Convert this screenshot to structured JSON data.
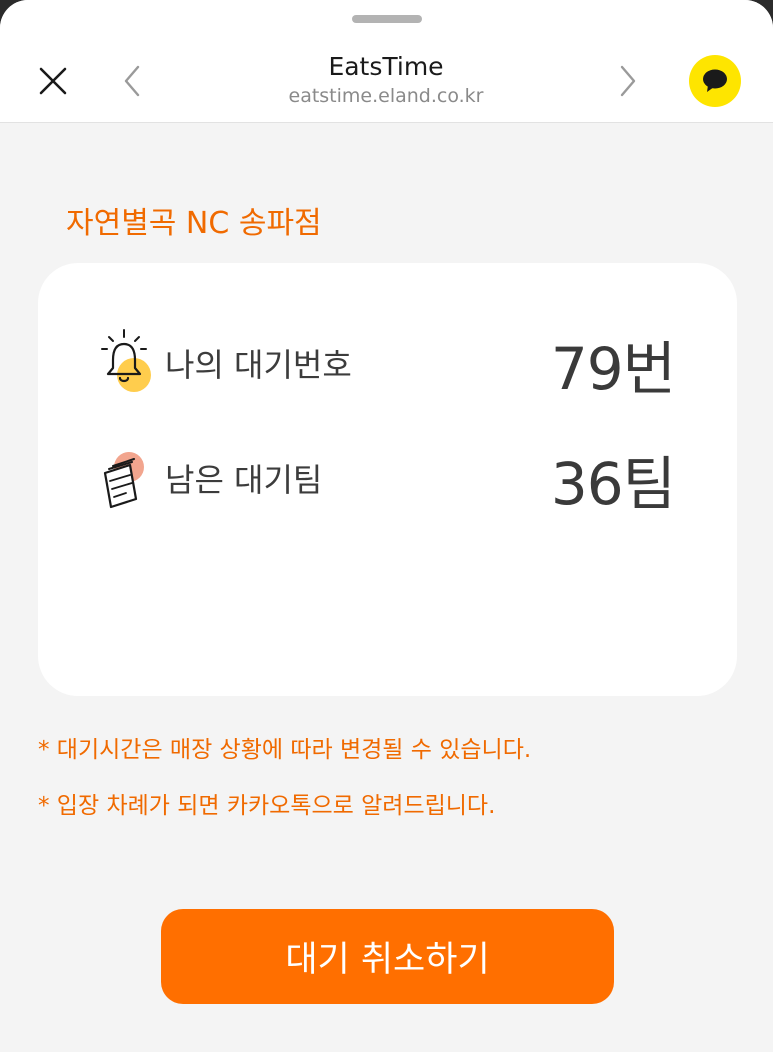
{
  "header": {
    "title": "EatsTime",
    "url": "eatstime.eland.co.kr",
    "icons": [
      "close-icon",
      "chevron-left-icon",
      "chevron-right-icon",
      "kakaotalk-icon"
    ]
  },
  "store": {
    "name": "자연별곡 NC 송파점"
  },
  "waiting": {
    "my_number_label": "나의 대기번호",
    "my_number_value": "79번",
    "remaining_label": "남은 대기팀",
    "remaining_value": "36팀"
  },
  "notices": [
    "* 대기시간은 매장 상황에 따라 변경될 수 있습니다.",
    "* 입장 차례가 되면 카카오톡으로 알려드립니다."
  ],
  "actions": {
    "cancel_label": "대기 취소하기"
  },
  "colors": {
    "accent": "#ff6f00",
    "accent_text": "#f06a00",
    "kakao_yellow": "#fee500",
    "background": "#f4f4f4",
    "card": "#ffffff"
  }
}
